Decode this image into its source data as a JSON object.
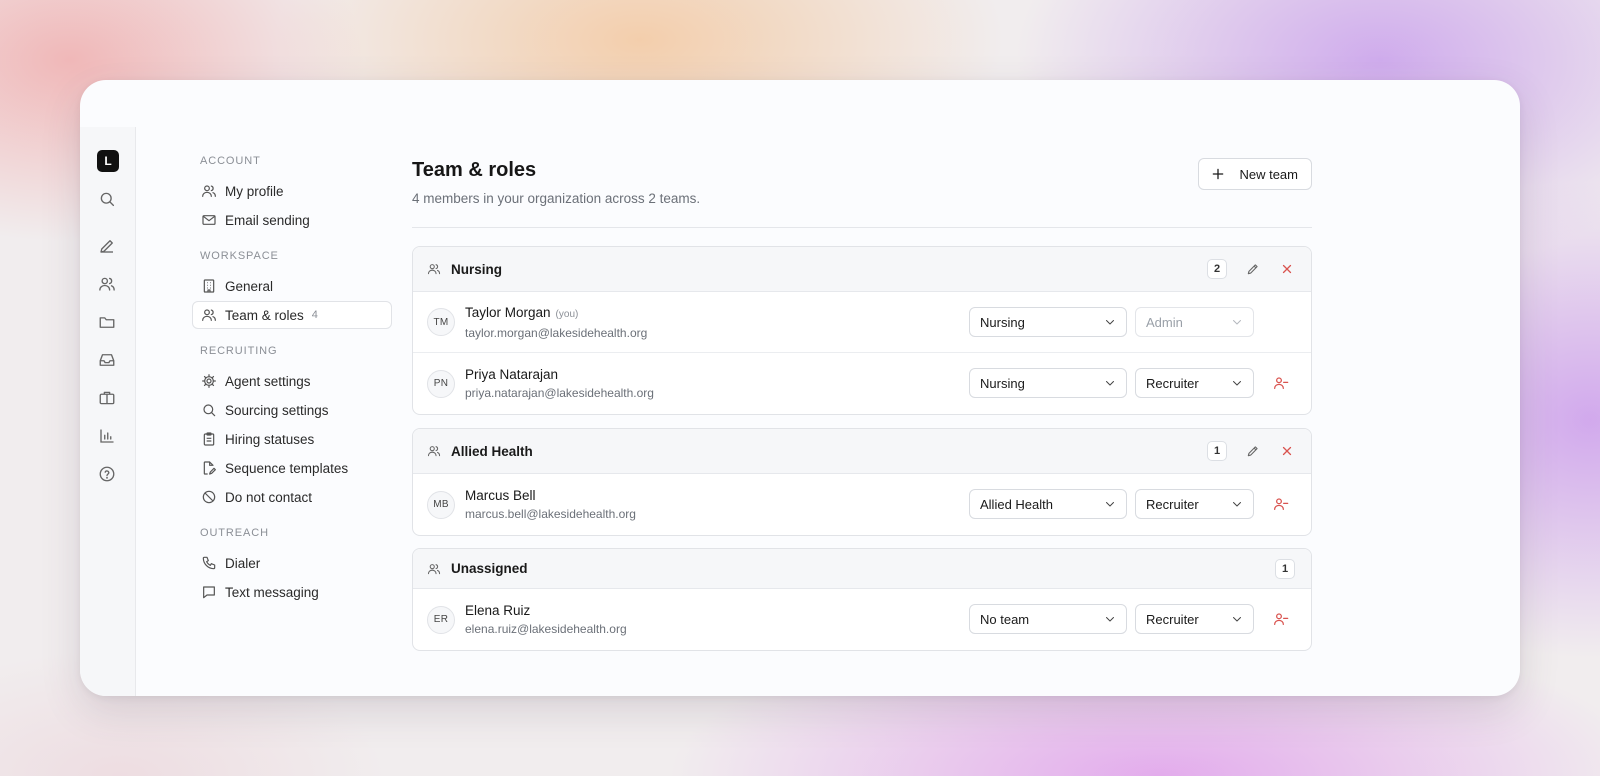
{
  "rail": {
    "logo": "L",
    "icons": [
      "search-icon",
      "pencil-icon",
      "users-icon",
      "folder-icon",
      "inbox-icon",
      "briefcase-icon",
      "bar-chart-icon",
      "help-icon"
    ]
  },
  "nav": {
    "sections": [
      {
        "title": "ACCOUNT",
        "items": [
          {
            "label": "My profile",
            "icon": "user-icon"
          },
          {
            "label": "Email sending",
            "icon": "mail-icon"
          }
        ]
      },
      {
        "title": "WORKSPACE",
        "items": [
          {
            "label": "General",
            "icon": "building-icon"
          },
          {
            "label": "Team & roles",
            "icon": "users-icon",
            "count": "4",
            "active": true
          }
        ]
      },
      {
        "title": "RECRUITING",
        "items": [
          {
            "label": "Agent settings",
            "icon": "gear-icon"
          },
          {
            "label": "Sourcing settings",
            "icon": "search-icon"
          },
          {
            "label": "Hiring statuses",
            "icon": "clipboard-icon"
          },
          {
            "label": "Sequence templates",
            "icon": "file-edit-icon"
          },
          {
            "label": "Do not contact",
            "icon": "ban-icon"
          }
        ]
      },
      {
        "title": "OUTREACH",
        "items": [
          {
            "label": "Dialer",
            "icon": "phone-icon"
          },
          {
            "label": "Text messaging",
            "icon": "message-icon"
          }
        ]
      }
    ]
  },
  "header": {
    "title": "Team & roles",
    "subtitle": "4 members in your organization across 2 teams.",
    "new_team_label": "New team"
  },
  "teams": [
    {
      "name": "Nursing",
      "count": "2",
      "members": [
        {
          "initials": "TM",
          "name": "Taylor Morgan",
          "you": "(you)",
          "email": "taylor.morgan@lakesidehealth.org",
          "team": "Nursing",
          "role": "Admin",
          "role_disabled": true
        },
        {
          "initials": "PN",
          "name": "Priya Natarajan",
          "email": "priya.natarajan@lakesidehealth.org",
          "team": "Nursing",
          "role": "Recruiter"
        }
      ]
    },
    {
      "name": "Allied Health",
      "count": "1",
      "members": [
        {
          "initials": "MB",
          "name": "Marcus Bell",
          "email": "marcus.bell@lakesidehealth.org",
          "team": "Allied Health",
          "role": "Recruiter"
        }
      ]
    },
    {
      "name": "Unassigned",
      "count": "1",
      "members": [
        {
          "initials": "ER",
          "name": "Elena Ruiz",
          "email": "elena.ruiz@lakesidehealth.org",
          "team": "No team",
          "role": "Recruiter"
        }
      ]
    }
  ]
}
